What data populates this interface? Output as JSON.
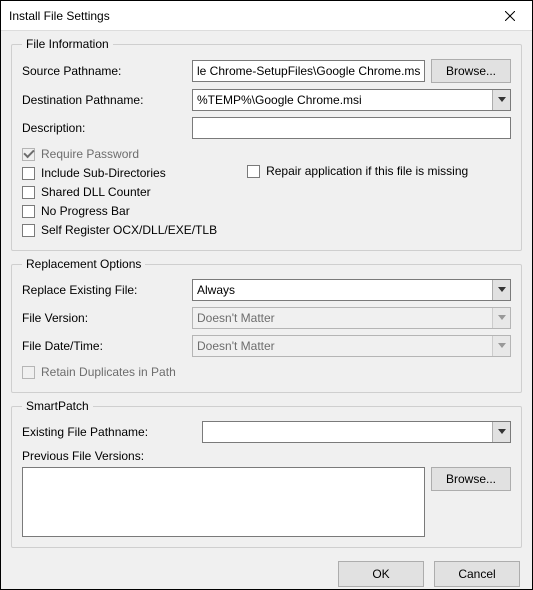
{
  "window": {
    "title": "Install File Settings"
  },
  "fileInfo": {
    "legend": "File Information",
    "sourceLabel": "Source Pathname:",
    "sourceValue": "le Chrome-SetupFiles\\Google Chrome.msi",
    "browse": "Browse...",
    "destLabel": "Destination Pathname:",
    "destValue": "%TEMP%\\Google Chrome.msi",
    "descLabel": "Description:",
    "descValue": "",
    "requirePassword": "Require Password",
    "includeSub": "Include Sub-Directories",
    "sharedDll": "Shared DLL Counter",
    "noProgress": "No Progress Bar",
    "selfRegister": "Self Register OCX/DLL/EXE/TLB",
    "repair": "Repair application if this file is missing"
  },
  "replacement": {
    "legend": "Replacement Options",
    "replaceLabel": "Replace Existing File:",
    "replaceValue": "Always",
    "versionLabel": "File Version:",
    "versionValue": "Doesn't Matter",
    "dateLabel": "File Date/Time:",
    "dateValue": "Doesn't Matter",
    "retain": "Retain Duplicates in Path"
  },
  "smart": {
    "legend": "SmartPatch",
    "existingLabel": "Existing File Pathname:",
    "existingValue": "",
    "prevLabel": "Previous File Versions:",
    "browse": "Browse..."
  },
  "buttons": {
    "ok": "OK",
    "cancel": "Cancel"
  }
}
